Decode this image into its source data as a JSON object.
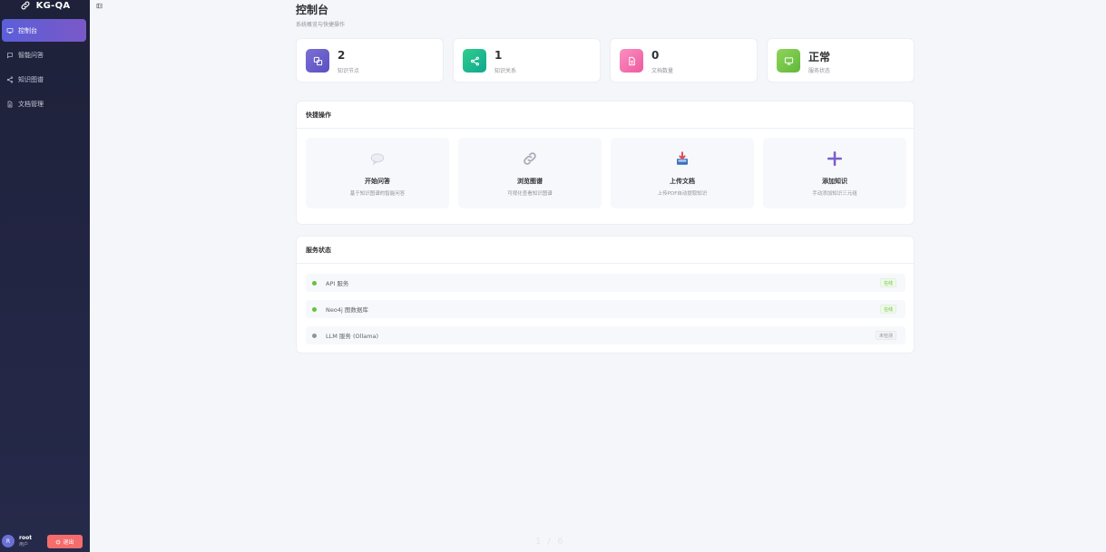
{
  "app": {
    "title": "KG-QA"
  },
  "sidebar": {
    "items": [
      {
        "label": "控制台",
        "icon": "monitor-icon",
        "active": true
      },
      {
        "label": "智能问答",
        "icon": "chat-icon",
        "active": false
      },
      {
        "label": "知识图谱",
        "icon": "share-icon",
        "active": false
      },
      {
        "label": "文档管理",
        "icon": "document-icon",
        "active": false
      }
    ]
  },
  "user": {
    "avatar": "R",
    "name": "root",
    "role": "用户",
    "logout_label": "退出"
  },
  "page": {
    "title": "控制台",
    "subtitle": "系统概览与快捷操作"
  },
  "stats": [
    {
      "value": "2",
      "label": "知识节点",
      "icon": "nodes-icon",
      "color": "#6a5acd"
    },
    {
      "value": "1",
      "label": "知识关系",
      "icon": "share-icon",
      "color": "#1bb38a"
    },
    {
      "value": "0",
      "label": "文档数量",
      "icon": "document-icon",
      "color": "#f36fae"
    },
    {
      "value": "正常",
      "label": "服务状态",
      "icon": "monitor-icon",
      "color": "#7cc84a"
    }
  ],
  "quick_actions": {
    "title": "快捷操作",
    "items": [
      {
        "title": "开始问答",
        "desc": "基于知识图谱的智能问答",
        "icon": "speech-bubble-icon"
      },
      {
        "title": "浏览图谱",
        "desc": "可视化查看知识图谱",
        "icon": "link-icon"
      },
      {
        "title": "上传文档",
        "desc": "上传PDF自动提取知识",
        "icon": "inbox-tray-icon"
      },
      {
        "title": "添加知识",
        "desc": "手动添加知识三元组",
        "icon": "plus-icon"
      }
    ]
  },
  "service_status": {
    "title": "服务状态",
    "items": [
      {
        "name": "API 服务",
        "status": "在线",
        "state": "online",
        "color": "#67c23a"
      },
      {
        "name": "Neo4j 图数据库",
        "status": "在线",
        "state": "online",
        "color": "#67c23a"
      },
      {
        "name": "LLM 服务 (Ollama)",
        "status": "未检测",
        "state": "unknown",
        "color": "#909399"
      }
    ]
  },
  "pager": {
    "text": "1 / 6"
  }
}
